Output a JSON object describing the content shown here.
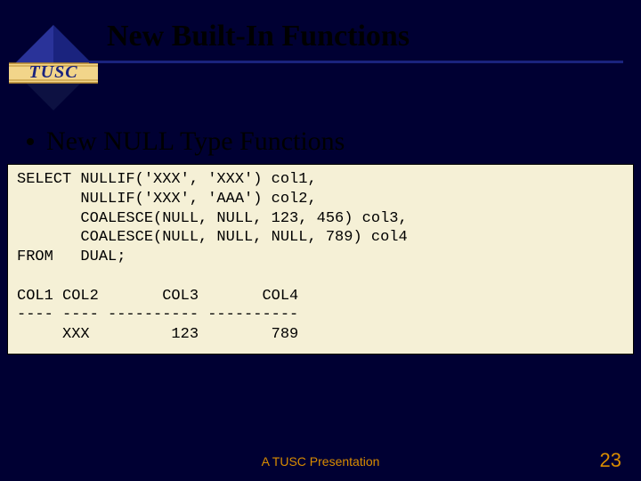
{
  "logo_text": "TUSC",
  "title": "New Built-In Functions",
  "bullet": "New NULL Type Functions",
  "code": "SELECT NULLIF('XXX', 'XXX') col1,\n       NULLIF('XXX', 'AAA') col2,\n       COALESCE(NULL, NULL, 123, 456) col3,\n       COALESCE(NULL, NULL, NULL, 789) col4\nFROM   DUAL;\n\nCOL1 COL2       COL3       COL4\n---- ---- ---------- ----------\n     XXX         123        789",
  "footer": "A TUSC Presentation",
  "page_number": "23",
  "colors": {
    "bg": "#000033",
    "accent": "#d98c00",
    "code_bg": "#f5f0d6",
    "logo_blue": "#1a237e",
    "logo_dark": "#0d1142",
    "logo_gold_light": "#f2d58a",
    "logo_gold_dark": "#b88a2e"
  }
}
